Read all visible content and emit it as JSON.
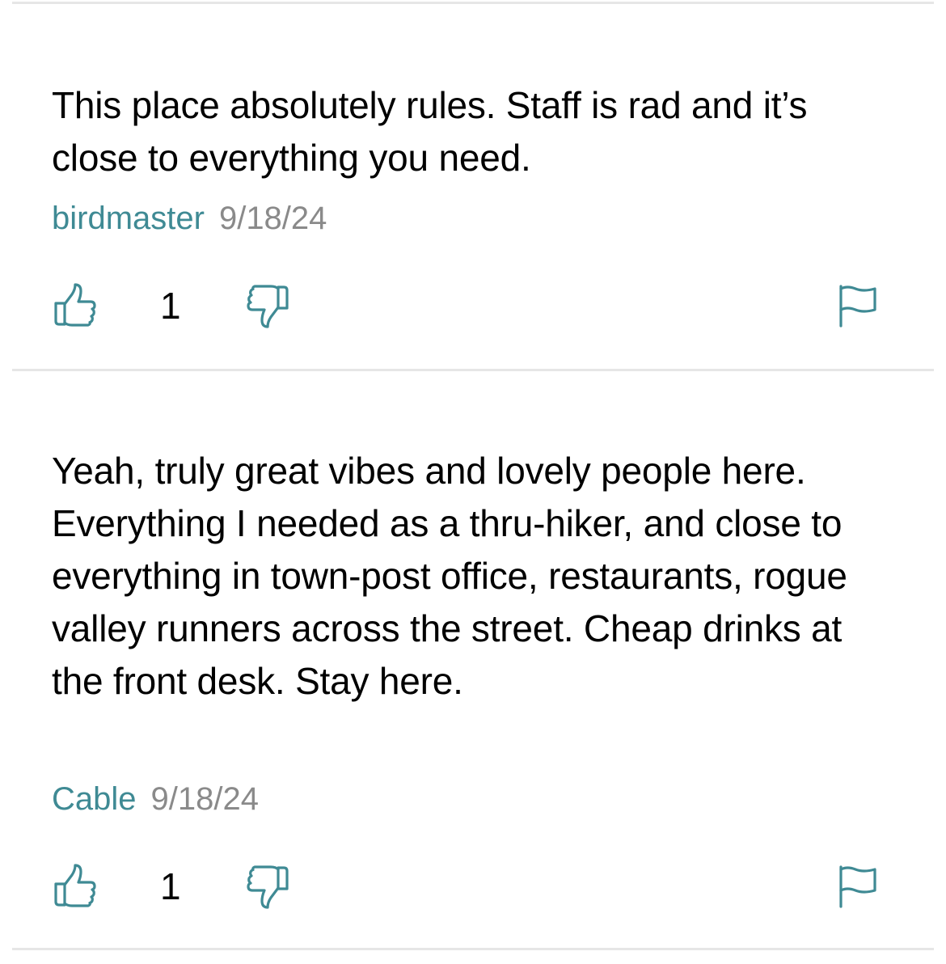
{
  "comments": [
    {
      "body": "This place absolutely rules.  Staff is rad and it’s close to everything you need.",
      "author": "birdmaster",
      "date": "9/18/24",
      "votes": "1"
    },
    {
      "body": "Yeah, truly great vibes and lovely people here.  Everything I needed as a thru-hiker, and close to everything in town-post office, restaurants, rogue valley runners across the street.  Cheap drinks at the front desk.  Stay here.",
      "author": "Cable",
      "date": "9/18/24",
      "votes": "1"
    }
  ],
  "icons": {
    "upvote": "thumbs-up-icon",
    "downvote": "thumbs-down-icon",
    "report": "flag-icon"
  },
  "colors": {
    "accent": "#3f8a94",
    "muted": "#8a8a8a",
    "divider": "#e6e6e6"
  }
}
